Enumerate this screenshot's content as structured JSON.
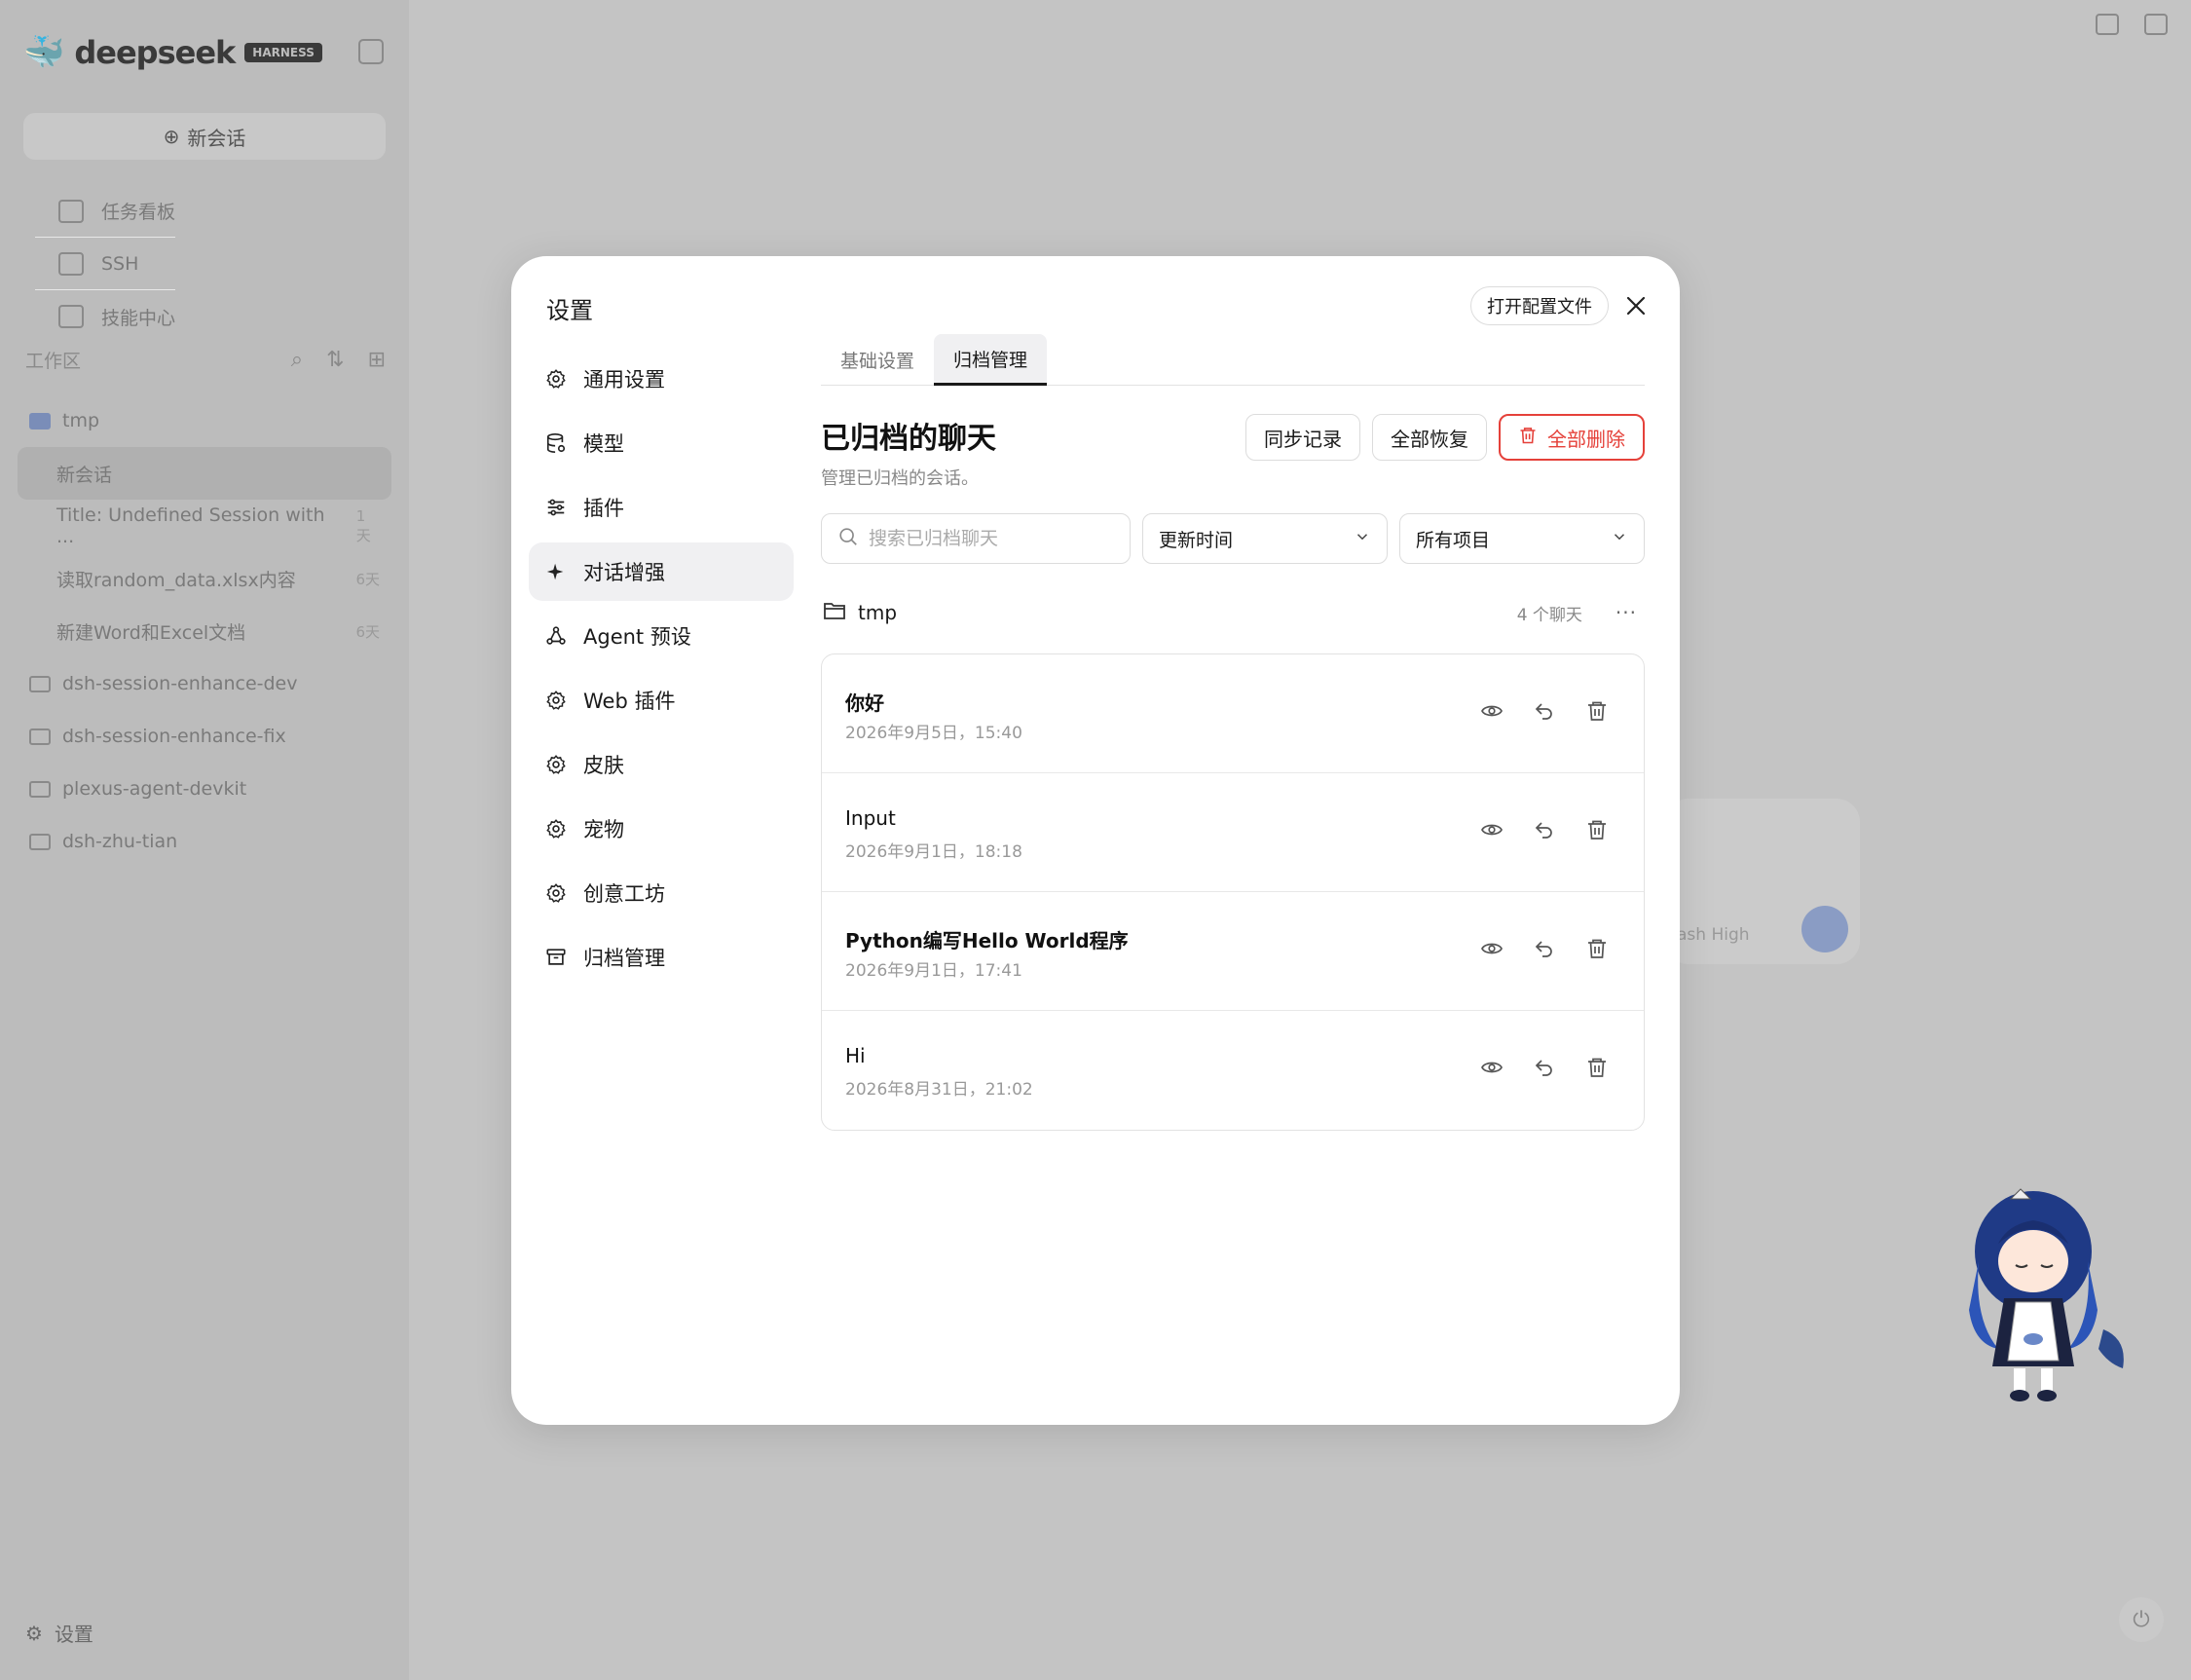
{
  "background": {
    "brand": "deepseek",
    "brand_badge": "HARNESS",
    "new_chat": "新会话",
    "nav": [
      "任务看板",
      "SSH",
      "技能中心"
    ],
    "workspace_label": "工作区",
    "workspaces": [
      {
        "name": "tmp",
        "sessions": [
          {
            "title": "新会话",
            "age": ""
          },
          {
            "title": "Title: Undefined Session with ...",
            "age": "1天"
          },
          {
            "title": "读取random_data.xlsx内容",
            "age": "6天"
          },
          {
            "title": "新建Word和Excel文档",
            "age": "6天"
          }
        ]
      },
      {
        "name": "dsh-session-enhance-dev"
      },
      {
        "name": "dsh-session-enhance-fix"
      },
      {
        "name": "plexus-agent-devkit"
      },
      {
        "name": "dsh-zhu-tian"
      }
    ],
    "settings_label": "设置",
    "model_hint": "ash High",
    "colors": {
      "accent": "#8a9cc4"
    }
  },
  "modal": {
    "title": "设置",
    "open_config": "打开配置文件",
    "nav": [
      {
        "label": "通用设置",
        "icon": "gear-icon"
      },
      {
        "label": "模型",
        "icon": "database-icon"
      },
      {
        "label": "插件",
        "icon": "sliders-icon"
      },
      {
        "label": "对话增强",
        "icon": "sparkle-icon",
        "active": true
      },
      {
        "label": "Agent 预设",
        "icon": "agent-icon"
      },
      {
        "label": "Web 插件",
        "icon": "gear-icon"
      },
      {
        "label": "皮肤",
        "icon": "gear-icon"
      },
      {
        "label": "宠物",
        "icon": "gear-icon"
      },
      {
        "label": "创意工坊",
        "icon": "gear-icon"
      },
      {
        "label": "归档管理",
        "icon": "archive-icon"
      }
    ],
    "tabs": [
      {
        "label": "基础设置",
        "active": false
      },
      {
        "label": "归档管理",
        "active": true
      }
    ],
    "section": {
      "title": "已归档的聊天",
      "subtitle": "管理已归档的会话。",
      "actions": {
        "sync": "同步记录",
        "restore_all": "全部恢复",
        "delete_all": "全部删除"
      },
      "search_placeholder": "搜索已归档聊天",
      "sort_value": "更新时间",
      "project_value": "所有项目"
    },
    "group": {
      "name": "tmp",
      "count": "4 个聊天",
      "items": [
        {
          "title": "你好",
          "date": "2026年9月5日，15:40"
        },
        {
          "title": "Input",
          "date": "2026年9月1日，18:18"
        },
        {
          "title": "Python编写Hello World程序",
          "date": "2026年9月1日，17:41"
        },
        {
          "title": "Hi",
          "date": "2026年8月31日，21:02"
        }
      ]
    },
    "colors": {
      "danger": "#e5413a",
      "active_bg": "#f0f0f2"
    }
  }
}
